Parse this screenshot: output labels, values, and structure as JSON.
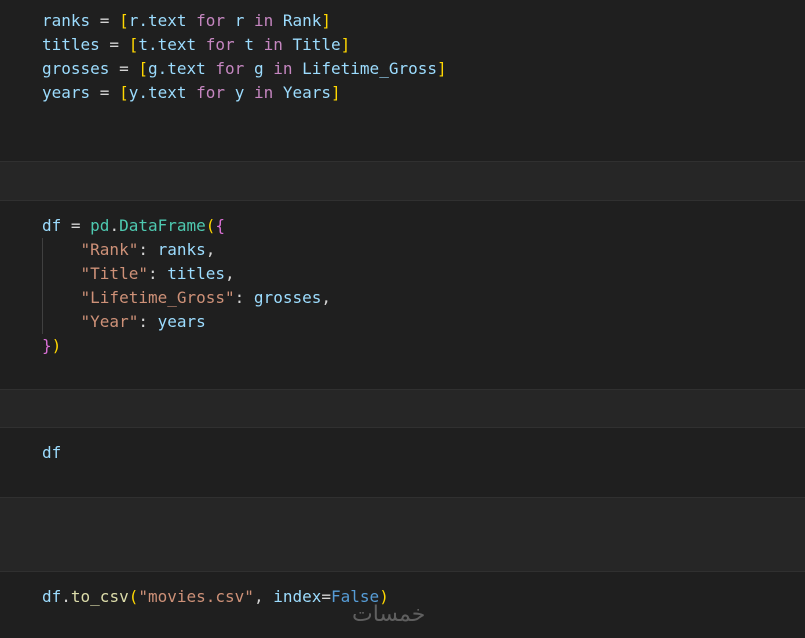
{
  "cells": {
    "cell1": {
      "line1": {
        "var": "ranks",
        "eq": " = ",
        "open": "[",
        "expr": "r.text",
        "for_kw": " for ",
        "loopvar": "r",
        "in_kw": " in ",
        "iter": "Rank",
        "close": "]"
      },
      "line2": {
        "var": "titles",
        "eq": " = ",
        "open": "[",
        "expr": "t.text",
        "for_kw": " for ",
        "loopvar": "t",
        "in_kw": " in ",
        "iter": "Title",
        "close": "]"
      },
      "line3": {
        "var": "grosses",
        "eq": " = ",
        "open": "[",
        "expr": "g.text",
        "for_kw": " for ",
        "loopvar": "g",
        "in_kw": " in ",
        "iter": "Lifetime_Gross",
        "close": "]"
      },
      "line4": {
        "var": "years",
        "eq": " = ",
        "open": "[",
        "expr": "y.text",
        "for_kw": " for ",
        "loopvar": "y",
        "in_kw": " in ",
        "iter": "Years",
        "close": "]"
      }
    },
    "cell2": {
      "line1": {
        "var": "df",
        "eq": " = ",
        "obj": "pd",
        "dot": ".",
        "cls": "DataFrame",
        "open_paren": "(",
        "open_brace": "{"
      },
      "line2": {
        "key": "\"Rank\"",
        "colon": ": ",
        "val": "ranks",
        "comma": ","
      },
      "line3": {
        "key": "\"Title\"",
        "colon": ": ",
        "val": "titles",
        "comma": ","
      },
      "line4": {
        "key": "\"Lifetime_Gross\"",
        "colon": ": ",
        "val": "grosses",
        "comma": ","
      },
      "line5": {
        "key": "\"Year\"",
        "colon": ": ",
        "val": "years"
      },
      "line6": {
        "close_brace": "}",
        "close_paren": ")"
      }
    },
    "cell3": {
      "line1": {
        "var": "df"
      }
    },
    "cell4": {
      "line1": {
        "obj": "df",
        "dot": ".",
        "fn": "to_csv",
        "open": "(",
        "arg": "\"movies.csv\"",
        "sep": ", ",
        "kwarg": "index",
        "eq": "=",
        "val": "False",
        "close": ")"
      }
    }
  },
  "watermark": "خمسات"
}
